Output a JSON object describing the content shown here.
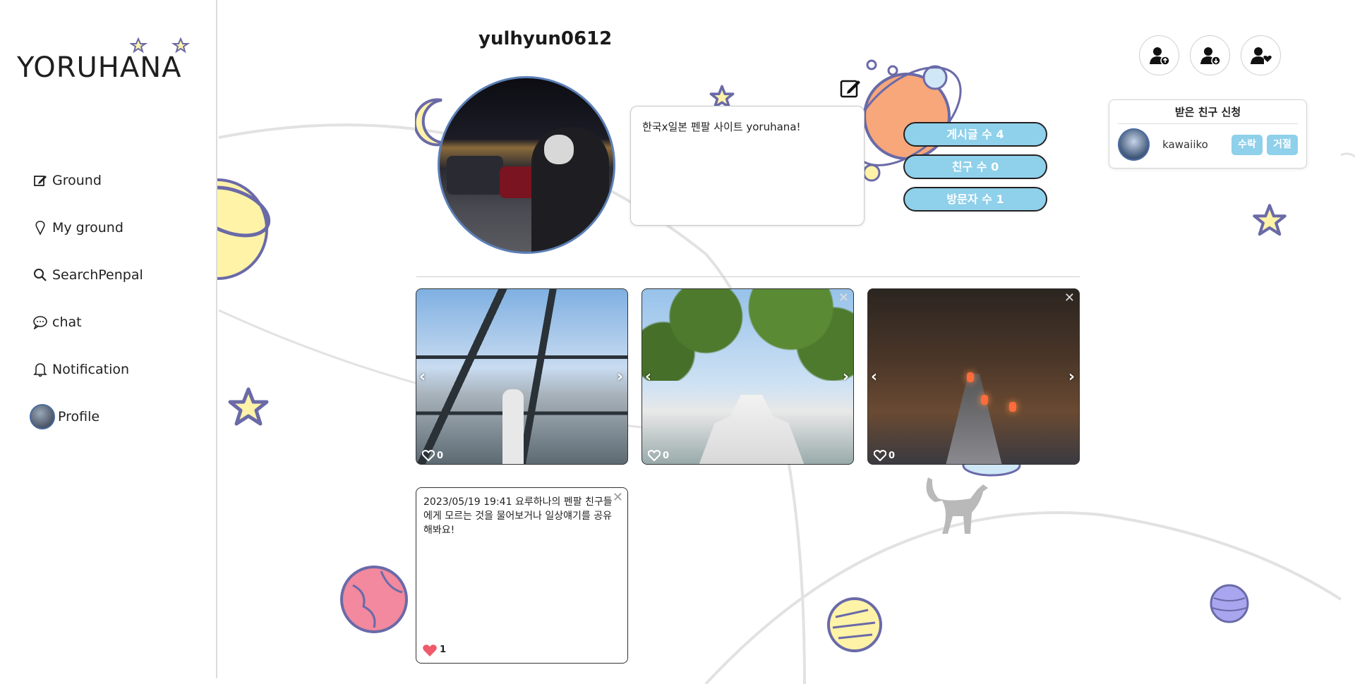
{
  "app": {
    "logo_text": "YORUHANA"
  },
  "sidebar": {
    "items": [
      {
        "label": "Ground",
        "icon": "edit-icon"
      },
      {
        "label": "My ground",
        "icon": "pin-icon"
      },
      {
        "label": "SearchPenpal",
        "icon": "search-icon"
      },
      {
        "label": "chat",
        "icon": "chat-icon"
      },
      {
        "label": "Notification",
        "icon": "bell-icon"
      },
      {
        "label": "Profile",
        "icon": "avatar"
      }
    ]
  },
  "profile": {
    "username": "yulhyun0612",
    "bio": "한국x일본 펜팔 사이트 yoruhana!",
    "stats": {
      "posts": "게시글 수 4",
      "friends": "친구 수 0",
      "visitors": "방문자 수 1"
    }
  },
  "friend_requests": {
    "title": "받은 친구 신청",
    "items": [
      {
        "name": "kawaiiko",
        "accept": "수락",
        "reject": "거절"
      }
    ]
  },
  "posts": [
    {
      "likes": "0"
    },
    {
      "likes": "0"
    },
    {
      "likes": "0"
    }
  ],
  "text_post": {
    "text": "2023/05/19 19:41 요루하나의 펜팔 친구들에게 모르는 것을 물어보거나 일상얘기를 공유해봐요!",
    "likes": "1"
  },
  "colors": {
    "accent": "#8fd0ea",
    "planet_outline": "#6a6aa8",
    "heart_red": "#f05a6a"
  }
}
